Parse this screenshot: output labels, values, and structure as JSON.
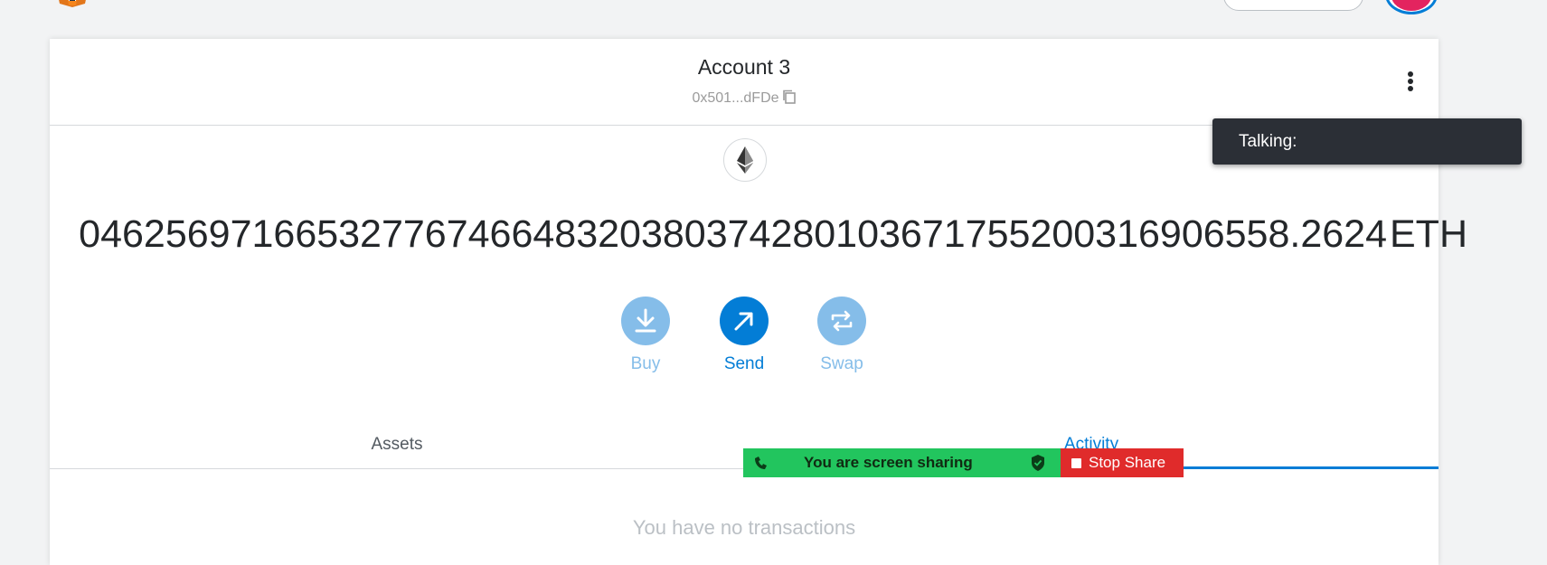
{
  "account": {
    "name": "Account 3",
    "address": "0x501...dFDe"
  },
  "balance": {
    "amount": "04625697166532776746648320380374280103671755200316906558.2624",
    "ticker": "ETH"
  },
  "actions": [
    {
      "label": "Buy"
    },
    {
      "label": "Send"
    },
    {
      "label": "Swap"
    }
  ],
  "tabs": [
    {
      "label": "Assets"
    },
    {
      "label": "Activity"
    }
  ],
  "activity": {
    "empty_message": "You have no transactions"
  },
  "screen_share": {
    "status": "You are screen sharing",
    "stop_label": "Stop Share"
  },
  "talking": {
    "label": "Talking:"
  },
  "colors": {
    "accent": "#037dd6",
    "accent_light": "#85bde9",
    "share_green": "#22c55e",
    "share_red": "#e02b2b"
  }
}
